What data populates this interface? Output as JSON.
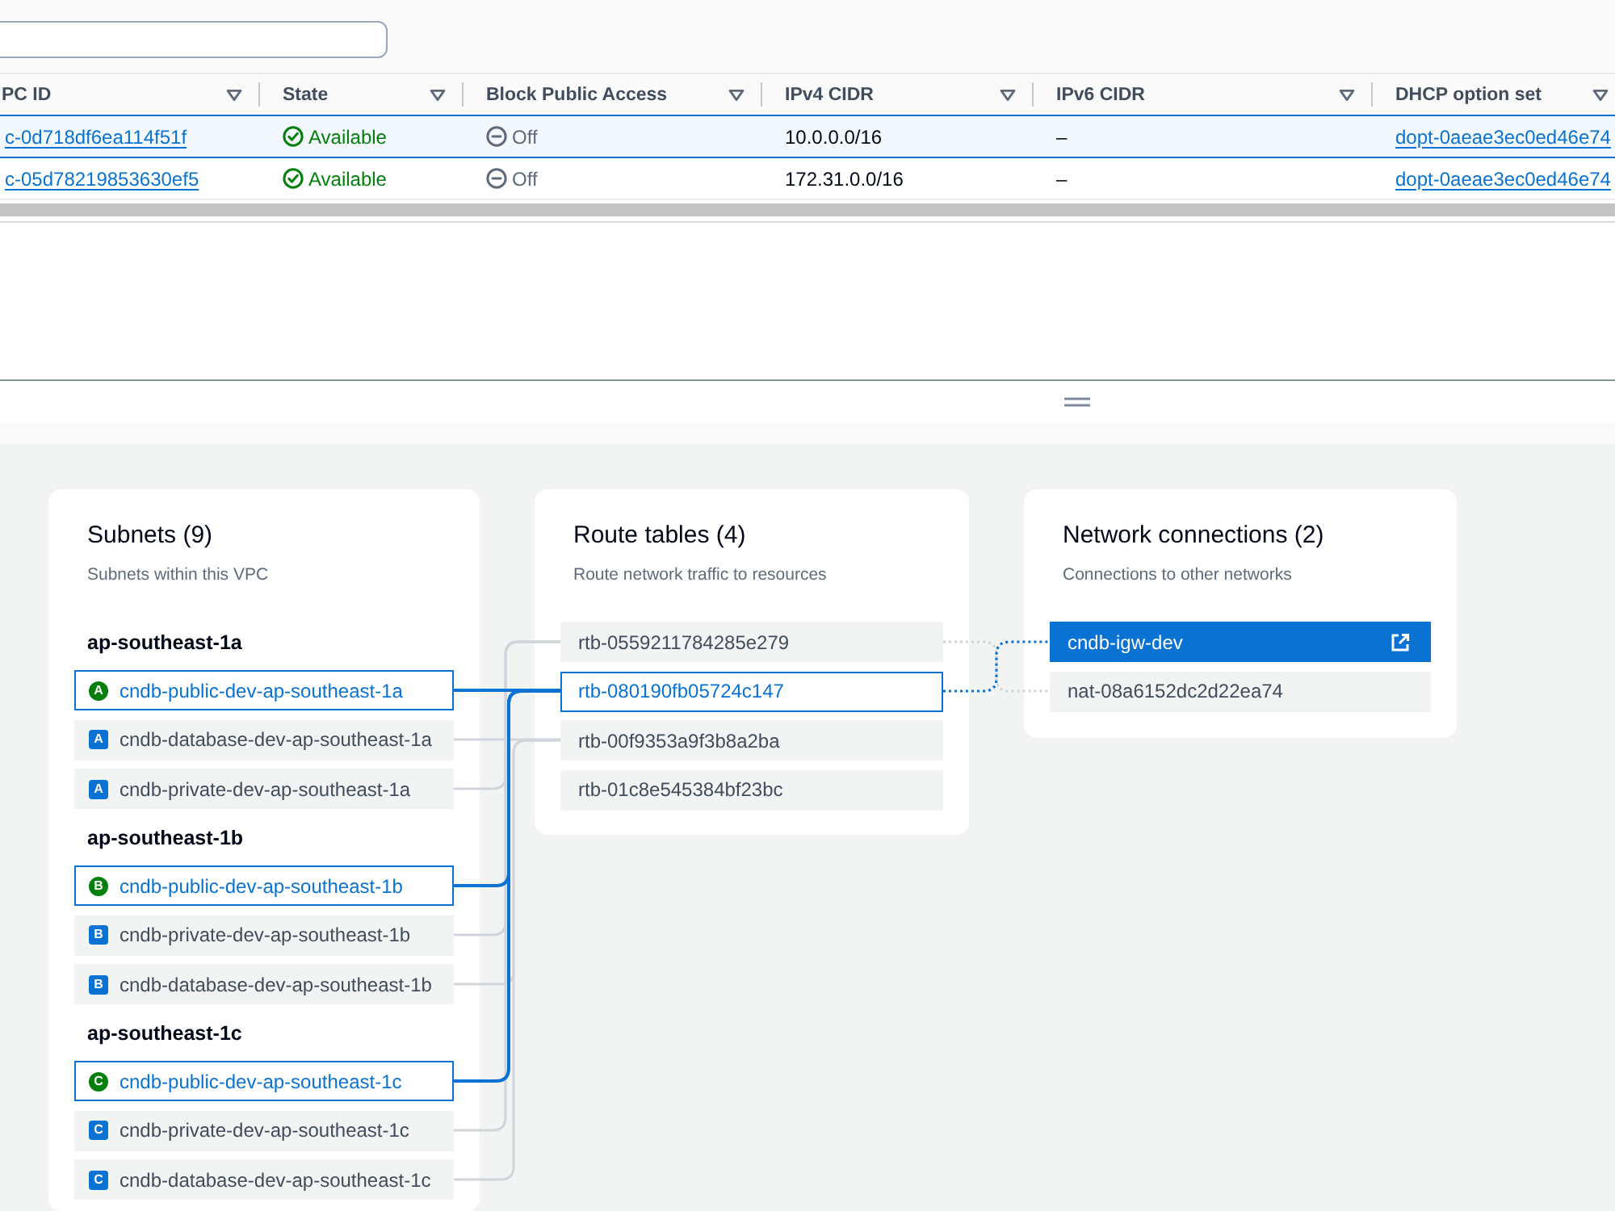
{
  "table": {
    "columns": [
      {
        "label": "PC ID"
      },
      {
        "label": "State"
      },
      {
        "label": "Block Public Access"
      },
      {
        "label": "IPv4 CIDR"
      },
      {
        "label": "IPv6 CIDR"
      },
      {
        "label": "DHCP option set"
      }
    ],
    "rows": [
      {
        "selected": true,
        "cells": [
          {
            "kind": "link",
            "text": "c-0d718df6ea114f51f"
          },
          {
            "kind": "status_ok",
            "text": "Available"
          },
          {
            "kind": "status_off",
            "text": "Off"
          },
          {
            "kind": "text",
            "text": "10.0.0.0/16"
          },
          {
            "kind": "text",
            "text": "–"
          },
          {
            "kind": "link",
            "text": "dopt-0aeae3ec0ed46e74"
          }
        ]
      },
      {
        "selected": false,
        "cells": [
          {
            "kind": "link",
            "text": "c-05d78219853630ef5"
          },
          {
            "kind": "status_ok",
            "text": "Available"
          },
          {
            "kind": "status_off",
            "text": "Off"
          },
          {
            "kind": "text",
            "text": "172.31.0.0/16"
          },
          {
            "kind": "text",
            "text": "–"
          },
          {
            "kind": "link",
            "text": "dopt-0aeae3ec0ed46e74"
          }
        ]
      }
    ]
  },
  "subnets": {
    "title": "Subnets (9)",
    "subtitle": "Subnets within this VPC",
    "groups": [
      {
        "zone": "ap-southeast-1a",
        "items": [
          {
            "name": "cndb-public-dev-ap-southeast-1a",
            "badge": "A",
            "kind": "public",
            "highlighted": true
          },
          {
            "name": "cndb-database-dev-ap-southeast-1a",
            "badge": "A",
            "kind": "database",
            "highlighted": false
          },
          {
            "name": "cndb-private-dev-ap-southeast-1a",
            "badge": "A",
            "kind": "private",
            "highlighted": false
          }
        ]
      },
      {
        "zone": "ap-southeast-1b",
        "items": [
          {
            "name": "cndb-public-dev-ap-southeast-1b",
            "badge": "B",
            "kind": "public",
            "highlighted": true
          },
          {
            "name": "cndb-private-dev-ap-southeast-1b",
            "badge": "B",
            "kind": "private",
            "highlighted": false
          },
          {
            "name": "cndb-database-dev-ap-southeast-1b",
            "badge": "B",
            "kind": "database",
            "highlighted": false
          }
        ]
      },
      {
        "zone": "ap-southeast-1c",
        "items": [
          {
            "name": "cndb-public-dev-ap-southeast-1c",
            "badge": "C",
            "kind": "public",
            "highlighted": true
          },
          {
            "name": "cndb-private-dev-ap-southeast-1c",
            "badge": "C",
            "kind": "private",
            "highlighted": false
          },
          {
            "name": "cndb-database-dev-ap-southeast-1c",
            "badge": "C",
            "kind": "database",
            "highlighted": false
          }
        ]
      }
    ]
  },
  "route_tables": {
    "title": "Route tables (4)",
    "subtitle": "Route network traffic to resources",
    "items": [
      {
        "name": "rtb-0559211784285e279",
        "highlighted": false
      },
      {
        "name": "rtb-080190fb05724c147",
        "highlighted": true
      },
      {
        "name": "rtb-00f9353a9f3b8a2ba",
        "highlighted": false
      },
      {
        "name": "rtb-01c8e545384bf23bc",
        "highlighted": false
      }
    ]
  },
  "network_connections": {
    "title": "Network connections (2)",
    "subtitle": "Connections to other networks",
    "items": [
      {
        "name": "cndb-igw-dev",
        "selected": true
      },
      {
        "name": "nat-08a6152dc2d22ea74",
        "selected": false
      }
    ]
  }
}
